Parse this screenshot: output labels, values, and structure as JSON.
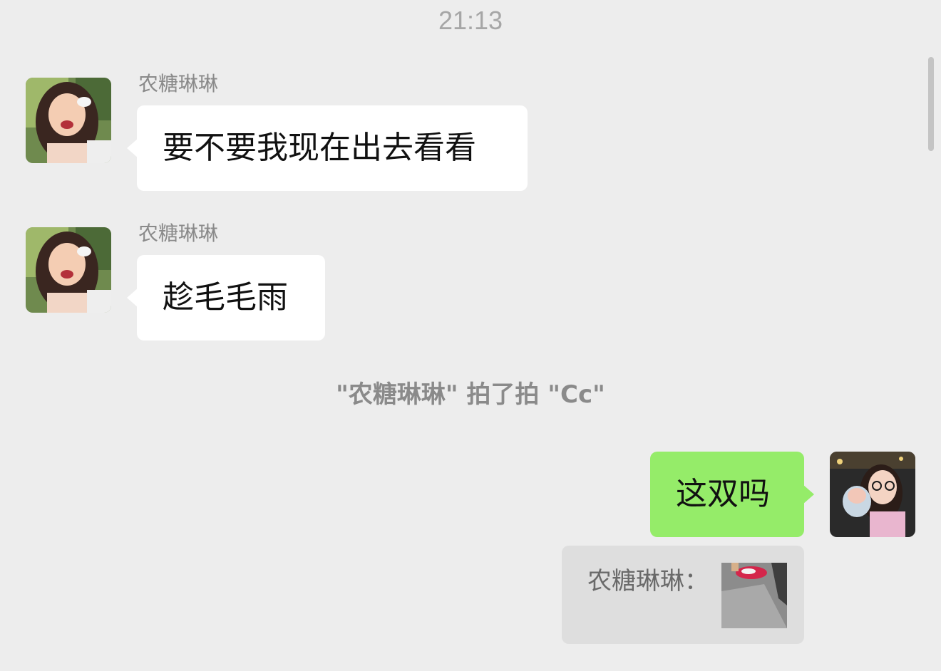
{
  "chat": {
    "timestamp": "21:13",
    "messages": [
      {
        "sender": "农糖琳琳",
        "text": "要不要我现在出去看看"
      },
      {
        "sender": "农糖琳琳",
        "text": "趁毛毛雨"
      }
    ],
    "system_message": "\"农糖琳琳\" 拍了拍 \"Cc\"",
    "my_message": {
      "text": "这双吗"
    },
    "quote": {
      "label": "农糖琳琳："
    }
  },
  "colors": {
    "background": "#ededed",
    "incoming_bubble": "#ffffff",
    "outgoing_bubble": "#95ec69",
    "quote_bg": "#dedede"
  },
  "icons": [
    "contact-avatar",
    "my-avatar",
    "quoted-image-thumbnail"
  ]
}
